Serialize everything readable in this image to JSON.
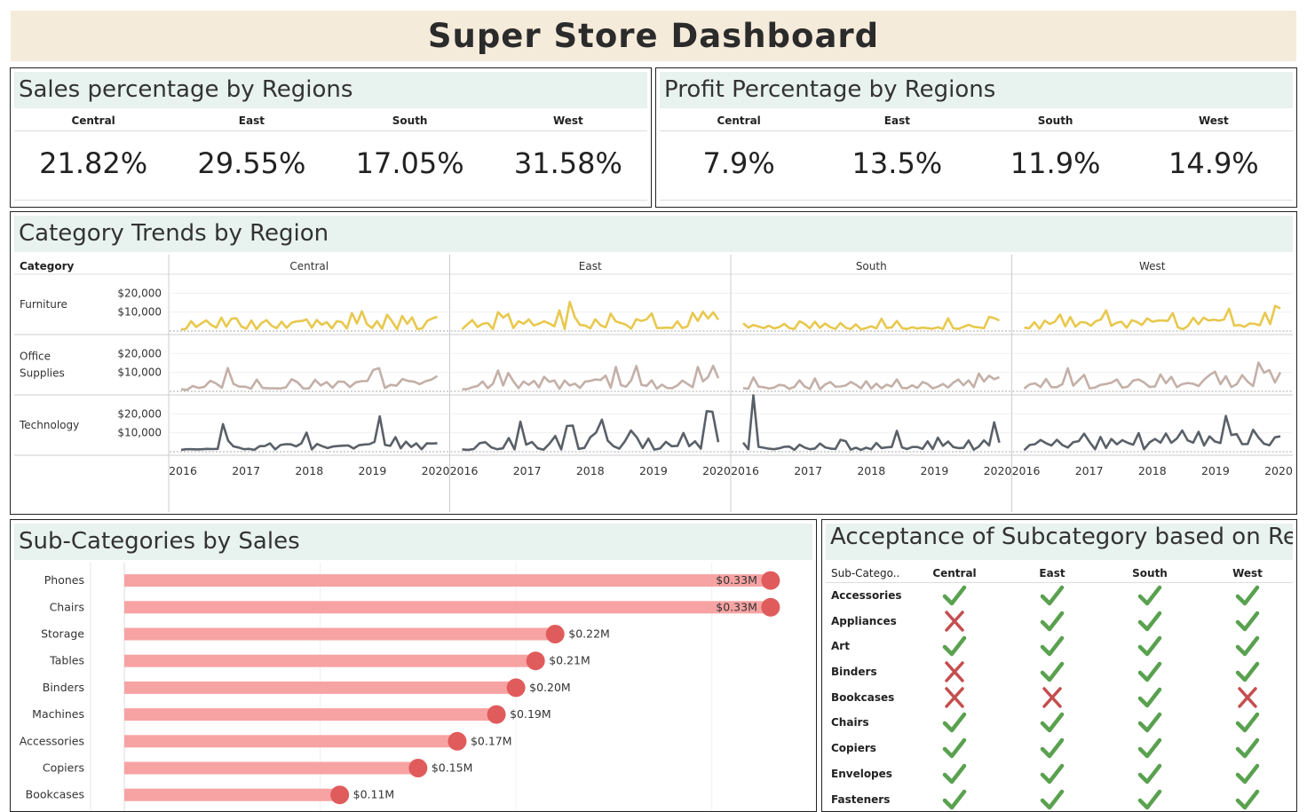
{
  "title": "Super Store Dashboard",
  "sales_panel": {
    "title": "Sales percentage by Regions",
    "regions": [
      "Central",
      "East",
      "South",
      "West"
    ],
    "values": [
      "21.82%",
      "29.55%",
      "17.05%",
      "31.58%"
    ]
  },
  "profit_panel": {
    "title": "Profit Percentage by Regions",
    "regions": [
      "Central",
      "East",
      "South",
      "West"
    ],
    "values": [
      "7.9%",
      "13.5%",
      "11.9%",
      "14.9%"
    ]
  },
  "trends_panel": {
    "title": "Category Trends by Region",
    "category_header": "Category"
  },
  "subcat_panel": {
    "title": "Sub-Categories by Sales"
  },
  "acceptance_panel": {
    "title": "Acceptance of Subcategory based on Region",
    "first_column_header": "Sub-Catego..",
    "regions": [
      "Central",
      "East",
      "South",
      "West"
    ],
    "rows": [
      {
        "name": "Accessories",
        "values": [
          true,
          true,
          true,
          true
        ]
      },
      {
        "name": "Appliances",
        "values": [
          false,
          true,
          true,
          true
        ]
      },
      {
        "name": "Art",
        "values": [
          true,
          true,
          true,
          true
        ]
      },
      {
        "name": "Binders",
        "values": [
          false,
          true,
          true,
          true
        ]
      },
      {
        "name": "Bookcases",
        "values": [
          false,
          false,
          true,
          false
        ]
      },
      {
        "name": "Chairs",
        "values": [
          true,
          true,
          true,
          true
        ]
      },
      {
        "name": "Copiers",
        "values": [
          true,
          true,
          true,
          true
        ]
      },
      {
        "name": "Envelopes",
        "values": [
          true,
          true,
          true,
          true
        ]
      },
      {
        "name": "Fasteners",
        "values": [
          true,
          true,
          true,
          true
        ]
      }
    ],
    "icons": {
      "accepted": "check-icon",
      "rejected": "cross-icon"
    },
    "colors": {
      "accepted": "#59a14f",
      "rejected": "#c44e4e"
    }
  },
  "chart_data": [
    {
      "type": "line",
      "panel": "Category Trends by Region",
      "columns": [
        "Central",
        "East",
        "South",
        "West"
      ],
      "rows": [
        "Furniture",
        "Office Supplies",
        "Technology"
      ],
      "row_labels": [
        [
          "Furniture"
        ],
        [
          "Office",
          "Supplies"
        ],
        [
          "Technology"
        ]
      ],
      "x_ticks": [
        "2016",
        "2017",
        "2018",
        "2019",
        "2020"
      ],
      "y_ticks": [
        {
          "value": 10000,
          "label": "$10,000"
        },
        {
          "value": 20000,
          "label": "$20,000"
        }
      ],
      "ylim": [
        0,
        30000
      ],
      "colors": {
        "Furniture": "#e8c84e",
        "Office Supplies": "#c4b0a8",
        "Technology": "#5a6068"
      },
      "series": {
        "Furniture": {
          "Central": [
            800,
            1200,
            5200,
            2100,
            4000,
            5600,
            3200,
            1800,
            7100,
            2300,
            6500,
            6700,
            2400,
            1200,
            5600,
            1000,
            4200,
            5700,
            2800,
            1500,
            4900,
            1700,
            4400,
            5100,
            5300,
            6100,
            1800,
            5800,
            3300,
            4700,
            1400,
            5200,
            4700,
            1300,
            9500,
            4000,
            10400,
            3600,
            1600,
            5200,
            1200,
            8600,
            5100,
            1000,
            7900,
            3800,
            7200,
            1100,
            1300,
            5400,
            6600,
            7500
          ],
          "East": [
            900,
            3500,
            5800,
            2100,
            3800,
            4200,
            1100,
            10000,
            7100,
            9000,
            1600,
            5200,
            3800,
            6100,
            2900,
            3900,
            5100,
            4000,
            2500,
            10900,
            1100,
            15400,
            7300,
            3200,
            2900,
            1400,
            6200,
            3100,
            1900,
            9200,
            5000,
            4200,
            3300,
            1200,
            6300,
            5300,
            6200,
            9300,
            1600,
            1600,
            1800,
            1600,
            5100,
            1500,
            2500,
            9600,
            5300,
            10200,
            6600,
            9900,
            6000
          ],
          "South": [
            4100,
            1800,
            3200,
            2400,
            1500,
            2800,
            1400,
            2000,
            3800,
            1600,
            1100,
            5100,
            3800,
            1400,
            4900,
            1700,
            4000,
            2000,
            1100,
            4200,
            1800,
            1100,
            3500,
            900,
            1600,
            2500,
            1400,
            6500,
            1600,
            1900,
            5300,
            1500,
            1100,
            2000,
            1300,
            1800,
            1500,
            1200,
            2000,
            1100,
            6700,
            1500,
            1100,
            2200,
            3300,
            2200,
            1900,
            1500,
            7500,
            6800,
            5600
          ],
          "West": [
            1800,
            1500,
            4700,
            1200,
            5500,
            3700,
            4900,
            8700,
            2500,
            7400,
            2300,
            4700,
            4500,
            2800,
            5200,
            6100,
            10900,
            2700,
            4300,
            4900,
            1700,
            5700,
            4800,
            3200,
            6700,
            4900,
            5500,
            5600,
            5300,
            9500,
            1900,
            1000,
            2700,
            7000,
            3500,
            7100,
            5600,
            6000,
            5500,
            6100,
            11800,
            2800,
            3200,
            2200,
            4000,
            3800,
            3000,
            9700,
            3600,
            13300,
            11900
          ]
        },
        "Office Supplies": {
          "Central": [
            1100,
            800,
            2800,
            1800,
            2400,
            5600,
            4200,
            1900,
            12300,
            3900,
            2500,
            2500,
            1400,
            6200,
            1800,
            1600,
            1600,
            1500,
            2100,
            6400,
            4800,
            1500,
            1600,
            6100,
            3100,
            4900,
            1900,
            5200,
            5000,
            2300,
            4800,
            5400,
            5500,
            11300,
            12300,
            1800,
            3400,
            3000,
            6500,
            5500,
            5100,
            3800,
            5400,
            6200,
            8100
          ],
          "East": [
            1100,
            1200,
            2200,
            2800,
            5200,
            1700,
            4000,
            11000,
            3100,
            9700,
            5300,
            1700,
            5200,
            3400,
            5600,
            2100,
            7700,
            5000,
            5700,
            1300,
            5700,
            3100,
            4100,
            1800,
            5200,
            5500,
            6300,
            6000,
            8300,
            1900,
            12900,
            3300,
            2500,
            5800,
            13400,
            3400,
            2900,
            5800,
            1400,
            3500,
            1800,
            1700,
            3100,
            5700,
            3900,
            2200,
            12900,
            5300,
            7600,
            13500,
            7000
          ],
          "South": [
            1700,
            1400,
            7300,
            2500,
            2200,
            1500,
            1900,
            3400,
            3100,
            1300,
            2400,
            5800,
            2600,
            1300,
            6800,
            1100,
            3600,
            4900,
            2500,
            2600,
            3100,
            4900,
            3500,
            1600,
            5400,
            1500,
            4100,
            1600,
            3500,
            2600,
            6300,
            1800,
            1700,
            3200,
            1800,
            4900,
            3900,
            1600,
            2500,
            3900,
            2000,
            4600,
            6300,
            3200,
            5800,
            2200,
            9400,
            5200,
            8300,
            6400,
            7500
          ],
          "West": [
            1500,
            3700,
            4200,
            2300,
            6500,
            2200,
            2200,
            3800,
            12200,
            3000,
            5900,
            8700,
            1600,
            2000,
            3400,
            3900,
            4600,
            6300,
            1900,
            2500,
            5700,
            6300,
            4700,
            2300,
            2600,
            8900,
            4300,
            7700,
            2200,
            3800,
            4400,
            4000,
            2800,
            6200,
            8600,
            10400,
            3800,
            8000,
            2300,
            3800,
            8600,
            5100,
            2800,
            15200,
            9800,
            11200,
            4700,
            10100
          ]
        },
        "Technology": {
          "Central": [
            1000,
            1300,
            1300,
            1200,
            1300,
            1500,
            1400,
            1500,
            14600,
            5800,
            2800,
            2200,
            1300,
            1500,
            1000,
            2900,
            3000,
            4400,
            1200,
            3500,
            4000,
            3900,
            2800,
            4400,
            10100,
            1200,
            4100,
            2900,
            1900,
            2700,
            3000,
            3200,
            3300,
            1700,
            3400,
            3800,
            4000,
            5200,
            18700,
            3600,
            3100,
            7700,
            1800,
            5300,
            2500,
            4400,
            1300,
            4400,
            4300,
            4500
          ],
          "East": [
            1200,
            1000,
            1400,
            4500,
            5000,
            2300,
            1300,
            1800,
            7200,
            1200,
            15900,
            3700,
            5100,
            1800,
            1100,
            4300,
            8300,
            1200,
            13600,
            13800,
            1500,
            2000,
            7600,
            10100,
            16900,
            5900,
            2900,
            1600,
            5700,
            11200,
            7600,
            1900,
            6900,
            1100,
            1700,
            5200,
            2900,
            3100,
            9900,
            2900,
            5500,
            1600,
            21400,
            21100,
            5000
          ],
          "South": [
            4800,
            1300,
            29800,
            2600,
            2100,
            1600,
            1300,
            1800,
            2600,
            2700,
            1000,
            3700,
            2200,
            1300,
            1700,
            4300,
            2300,
            1700,
            1400,
            6300,
            5600,
            1100,
            2100,
            1000,
            2100,
            1300,
            4600,
            1900,
            2300,
            2500,
            11000,
            2300,
            1400,
            2500,
            2500,
            1500,
            5500,
            1400,
            7400,
            3100,
            5400,
            2500,
            1900,
            2000,
            5900,
            1100,
            2700,
            6000,
            3300,
            15500,
            4800
          ],
          "West": [
            800,
            3500,
            4000,
            6200,
            4500,
            3300,
            6300,
            3500,
            2200,
            5000,
            5600,
            9500,
            5100,
            1300,
            7800,
            2000,
            6700,
            3900,
            6100,
            4700,
            3700,
            9800,
            1300,
            4900,
            6700,
            4800,
            9600,
            4700,
            7000,
            11200,
            6000,
            4800,
            10500,
            3300,
            8100,
            5400,
            4600,
            18900,
            8800,
            9300,
            4000,
            4100,
            11600,
            7500,
            4200,
            3400,
            7600,
            8100
          ]
        }
      }
    },
    {
      "type": "bar",
      "panel": "Sub-Categories by Sales",
      "categories": [
        "Phones",
        "Chairs",
        "Storage",
        "Tables",
        "Binders",
        "Machines",
        "Accessories",
        "Copiers",
        "Bookcases"
      ],
      "values": [
        0.33,
        0.33,
        0.22,
        0.21,
        0.2,
        0.19,
        0.17,
        0.15,
        0.11
      ],
      "value_labels": [
        "$0.33M",
        "$0.33M",
        "$0.22M",
        "$0.21M",
        "$0.20M",
        "$0.19M",
        "$0.17M",
        "$0.15M",
        "$0.11M"
      ],
      "xlim": [
        0,
        0.35
      ],
      "unit": "$M",
      "bar_color": "#f7a3a3",
      "dot_color": "#e05c5c"
    }
  ]
}
